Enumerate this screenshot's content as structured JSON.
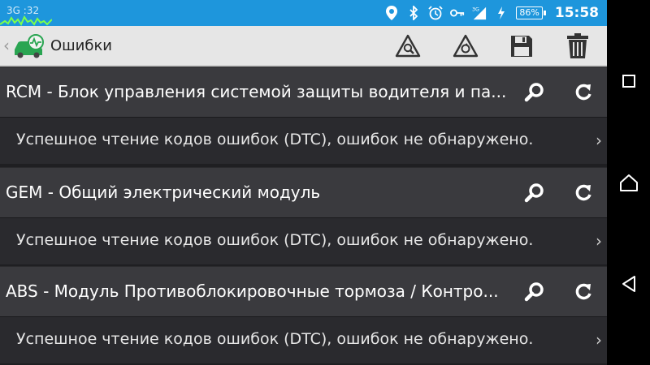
{
  "status_bar": {
    "left_label": "3G",
    "left_time": ":32",
    "battery": "86%",
    "network": "3G",
    "time": "15:58",
    "icons": [
      "location-icon",
      "bluetooth-icon",
      "alarm-icon",
      "key-icon",
      "signal-icon",
      "charging-icon"
    ]
  },
  "action_bar": {
    "title": "Ошибки",
    "actions": [
      "read-dtc-icon",
      "clear-dtc-icon",
      "save-icon",
      "delete-icon"
    ]
  },
  "modules": [
    {
      "name": "RCM - Блок управления системой защиты водителя и па...",
      "status": "Успешное чтение кодов ошибок (DTC), ошибок не обнаружено."
    },
    {
      "name": "GEM - Общий электрический модуль",
      "status": "Успешное чтение кодов ошибок (DTC), ошибок не обнаружено."
    },
    {
      "name": "ABS - Модуль Противоблокировочные тормоза / Контро...",
      "status": "Успешное чтение кодов ошибок (DTC), ошибок не обнаружено."
    }
  ],
  "colors": {
    "status_bar": "#1e96dc",
    "action_bar": "#e6e6e6",
    "module_row": "#3a3a3e",
    "status_row": "#2a2a2e",
    "nav_bar": "#000000"
  }
}
